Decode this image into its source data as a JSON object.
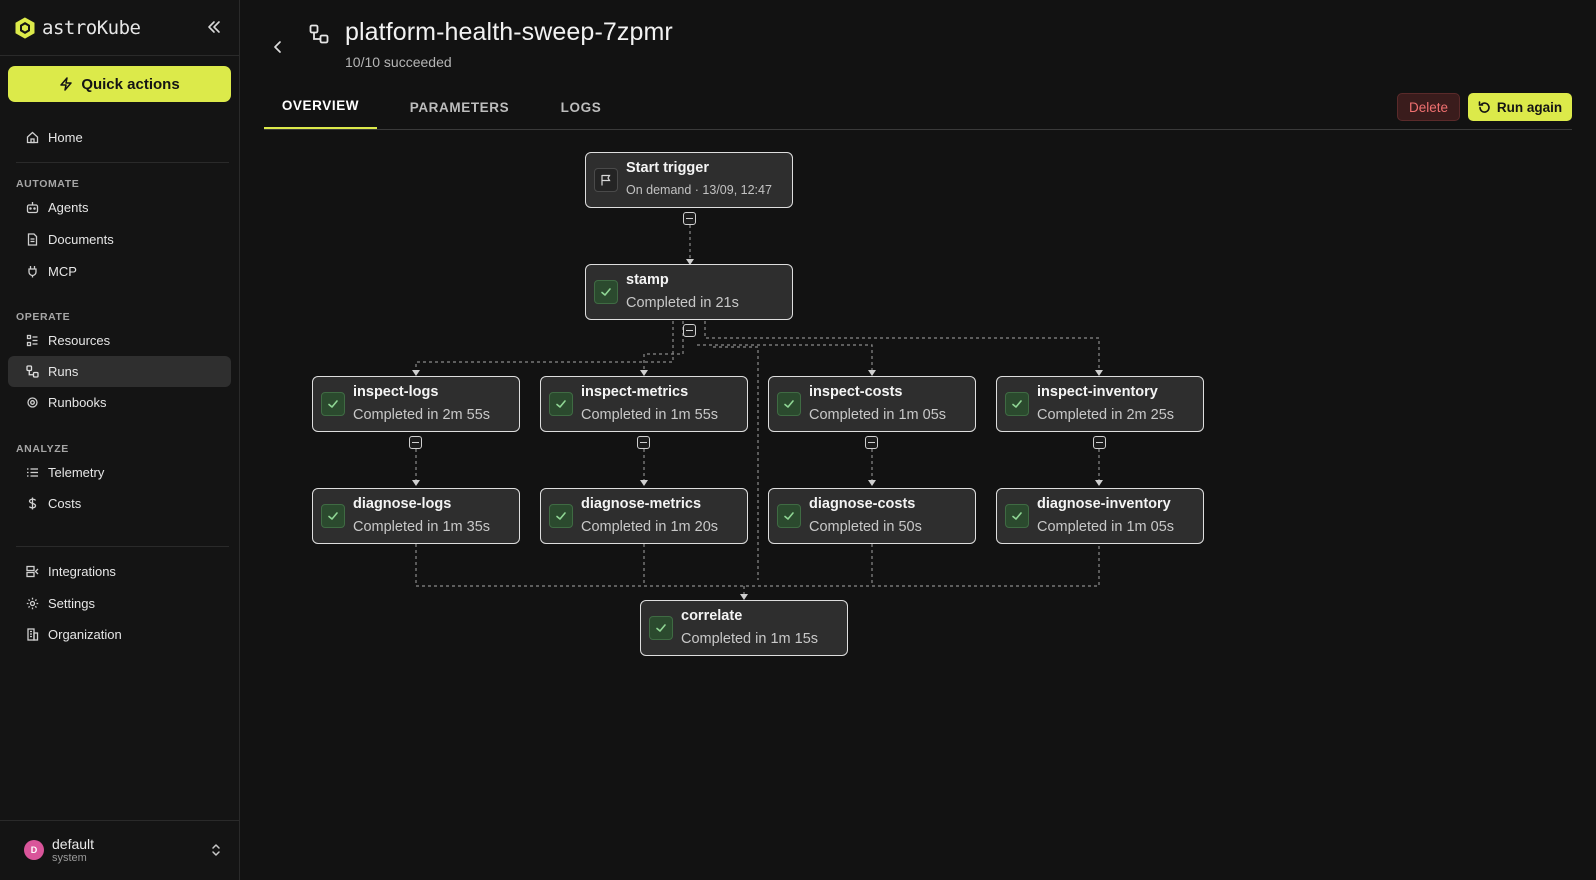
{
  "brand": {
    "name": "astroKube"
  },
  "sidebar": {
    "quick_actions": "Quick actions",
    "home": "Home",
    "sections": {
      "automate": "AUTOMATE",
      "operate": "OPERATE",
      "analyze": "ANALYZE"
    },
    "automate_items": [
      "Agents",
      "Documents",
      "MCP"
    ],
    "operate_items": [
      "Resources",
      "Runs",
      "Runbooks"
    ],
    "analyze_items": [
      "Telemetry",
      "Costs"
    ],
    "bottom_items": [
      "Integrations",
      "Settings",
      "Organization"
    ],
    "active_item": "Runs"
  },
  "user": {
    "initial": "D",
    "name": "default",
    "role": "system"
  },
  "run": {
    "title": "platform-health-sweep-7zpmr",
    "subtitle": "10/10 succeeded"
  },
  "tabs": [
    "OVERVIEW",
    "PARAMETERS",
    "LOGS"
  ],
  "active_tab": "OVERVIEW",
  "actions": {
    "delete": "Delete",
    "run_again": "Run again"
  },
  "graph": {
    "trigger": {
      "name": "Start trigger",
      "status": "On demand · 13/09, 12:47"
    },
    "nodes": [
      {
        "name": "stamp",
        "status": "Completed in 21s"
      },
      {
        "name": "inspect-logs",
        "status": "Completed in 2m 55s"
      },
      {
        "name": "inspect-metrics",
        "status": "Completed in 1m 55s"
      },
      {
        "name": "inspect-costs",
        "status": "Completed in 1m 05s"
      },
      {
        "name": "inspect-inventory",
        "status": "Completed in 2m 25s"
      },
      {
        "name": "diagnose-logs",
        "status": "Completed in 1m 35s"
      },
      {
        "name": "diagnose-metrics",
        "status": "Completed in 1m 20s"
      },
      {
        "name": "diagnose-costs",
        "status": "Completed in 50s"
      },
      {
        "name": "diagnose-inventory",
        "status": "Completed in 1m 05s"
      },
      {
        "name": "correlate",
        "status": "Completed in 1m 15s"
      }
    ]
  },
  "colors": {
    "accent": "#dcea4a",
    "danger": "#f07070",
    "success": "#4caf50"
  }
}
